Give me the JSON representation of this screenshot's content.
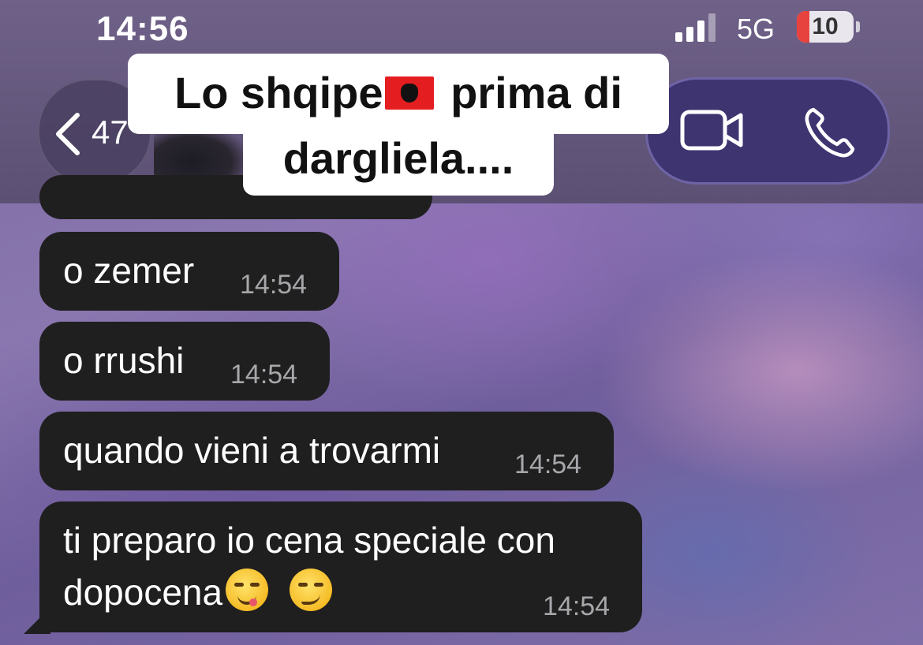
{
  "status_bar": {
    "time": "14:56",
    "network": "5G",
    "battery_level": "10",
    "battery_fraction": 0.1,
    "battery_color": "#e8423e"
  },
  "header": {
    "back_count": "47",
    "icons": [
      "chevron-left-icon",
      "video-camera-icon",
      "phone-icon"
    ],
    "call_pill_color": "#3e3470"
  },
  "caption": {
    "line1_before_flag": "Lo shqipe",
    "line1_after_flag": " prima di",
    "line2": "dargliela....",
    "flag_icon": "albania-flag-icon"
  },
  "messages": [
    {
      "text": "o zemer",
      "time": "14:54"
    },
    {
      "text": "o rrushi",
      "time": "14:54"
    },
    {
      "text": "quando vieni a trovarmi",
      "time": "14:54"
    },
    {
      "text_line1": "ti preparo io cena speciale con",
      "text_line2": "dopocena",
      "emojis": [
        "face-savoring-food-emoji",
        "smirking-face-emoji"
      ],
      "time": "14:54"
    }
  ],
  "colors": {
    "bubble": "#1f1f1f",
    "timestamp": "#a7a7ab"
  }
}
